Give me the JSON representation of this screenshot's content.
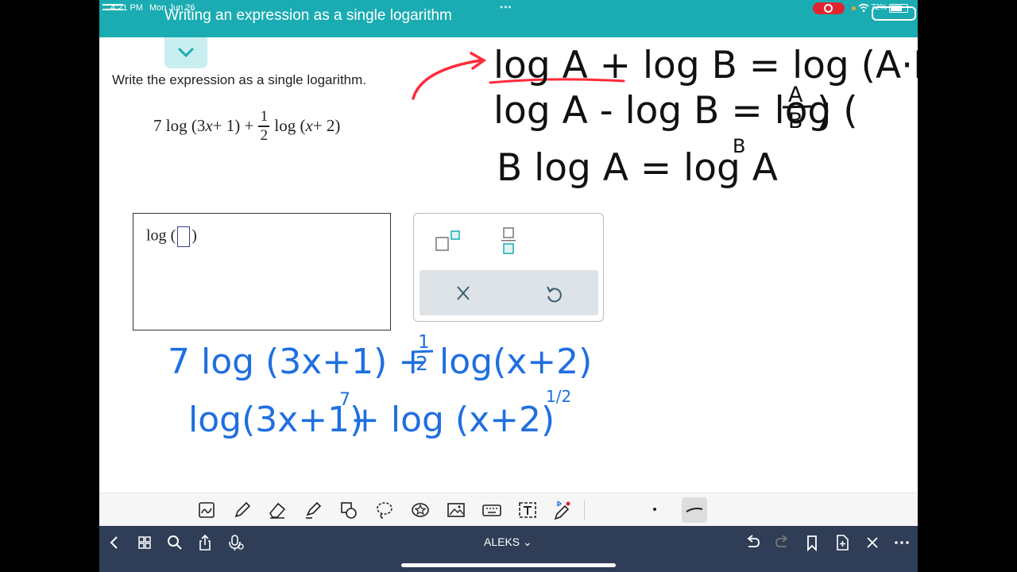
{
  "status": {
    "time": "4:21 PM",
    "date": "Mon Jun 26",
    "battery": "72%"
  },
  "header": {
    "title": "Writing an expression as a single logarithm"
  },
  "problem": {
    "instruction": "Write the expression as a single logarithm.",
    "expression": {
      "coef": "7",
      "log1": "log",
      "arg1_open": "(",
      "arg1_a": "3",
      "arg1_var": "x",
      "arg1_rest": " + 1",
      "arg1_close": ")",
      "plus": "+",
      "frac_num": "1",
      "frac_den": "2",
      "log2": "log",
      "arg2_open": "(",
      "arg2_var": "x",
      "arg2_rest": " + 2",
      "arg2_close": ")"
    }
  },
  "answer": {
    "log": "log",
    "open": "(",
    "close": ")"
  },
  "annotations": {
    "rule1": "log A + log B = log (A·B)",
    "rule2_left": "log A - log B = log (",
    "rule2_num": "A",
    "rule2_den": "B",
    "rule2_close": ")",
    "rule3": "B log A =  log A",
    "rule3_exp": "B",
    "work1_a": "7 log (3x+1) + ",
    "work1_num": "1",
    "work1_den": "2",
    "work1_b": "log(x+2)",
    "work2_a": "log(3x+1)",
    "work2_exp1": "7",
    "work2_b": " + log (x+2)",
    "work2_exp2": "1/2"
  },
  "ink_colors": {
    "black": "#111111",
    "blue": "#1f6fe0",
    "red": "#ff2a3a",
    "accent": "#1aacb2"
  },
  "bottom_nav": {
    "app": "ALEKS ⌄"
  }
}
